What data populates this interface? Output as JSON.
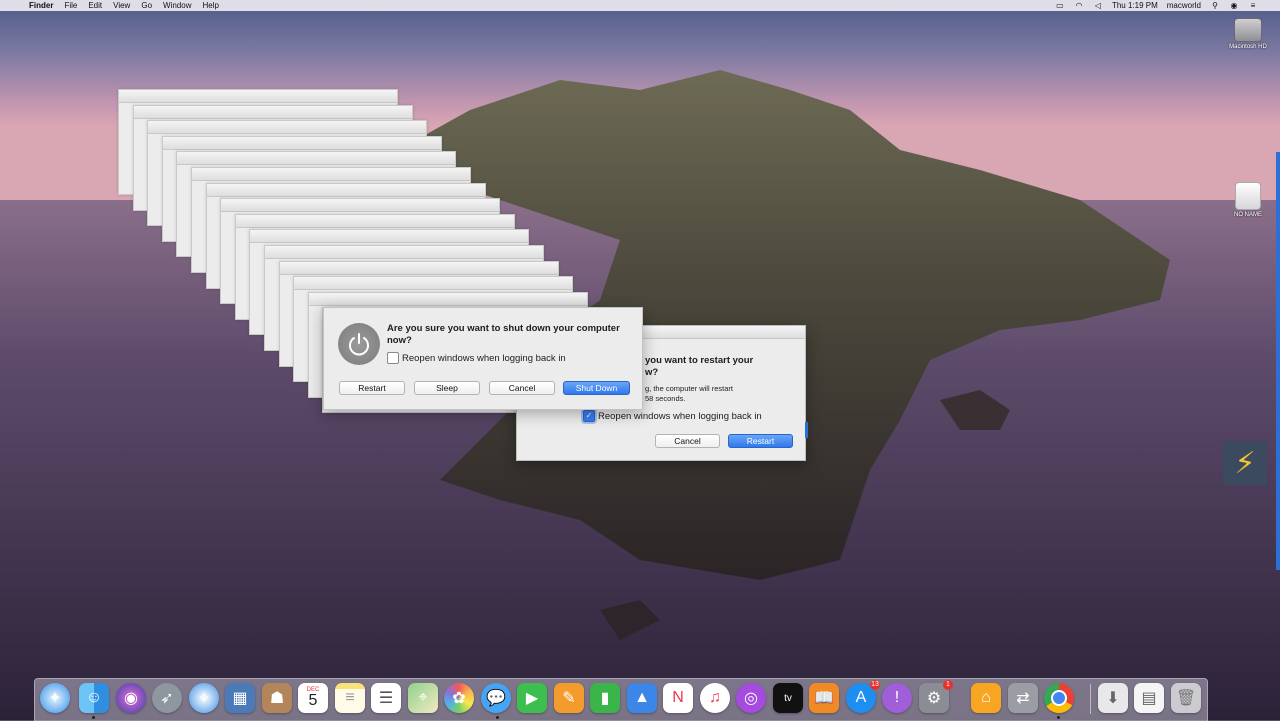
{
  "menubar": {
    "apple": "",
    "items": [
      "Finder",
      "File",
      "Edit",
      "View",
      "Go",
      "Window",
      "Help"
    ],
    "clock": "Thu 1:19 PM",
    "user": "macworld"
  },
  "desktop": {
    "hd_label": "Macintosh HD",
    "drive_label": "NO NAME"
  },
  "shutdown_dialog": {
    "title": "Are you sure you want to shut down your computer now?",
    "checkbox_label": "Reopen windows when logging back in",
    "checkbox_checked": false,
    "buttons": {
      "restart": "Restart",
      "sleep": "Sleep",
      "cancel": "Cancel",
      "shutdown": "Shut Down"
    }
  },
  "restart_dialog": {
    "title": "you want to restart your\nw?",
    "info": "g, the computer will restart\n58 seconds.",
    "checkbox_label": "Reopen windows when logging back in",
    "checkbox_checked": true,
    "buttons": {
      "cancel": "Cancel",
      "restart": "Restart"
    }
  },
  "dock": {
    "calendar_month": "DEC",
    "calendar_day": "5",
    "appstore_badge": "13",
    "prefs_badge": "1",
    "appletv_label": "tv"
  },
  "colors": {
    "accent": "#2f79ea",
    "dialog_bg": "#ececec"
  }
}
